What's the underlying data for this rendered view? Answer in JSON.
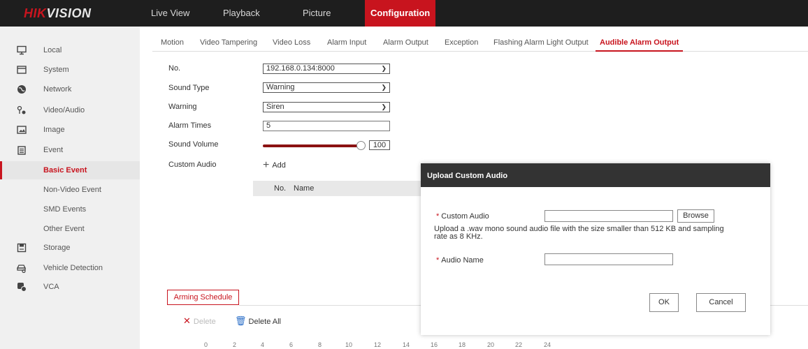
{
  "brand": {
    "part1": "HIK",
    "part2": "VISION"
  },
  "nav": {
    "items": [
      "Live View",
      "Playback",
      "Picture",
      "Configuration"
    ]
  },
  "sidebar": {
    "items": [
      {
        "label": "Local",
        "icon": "monitor-icon"
      },
      {
        "label": "System",
        "icon": "window-icon"
      },
      {
        "label": "Network",
        "icon": "globe-icon"
      },
      {
        "label": "Video/Audio",
        "icon": "camera-audio-icon"
      },
      {
        "label": "Image",
        "icon": "image-icon"
      },
      {
        "label": "Event",
        "icon": "calendar-icon"
      },
      {
        "label": "Basic Event"
      },
      {
        "label": "Non-Video Event"
      },
      {
        "label": "SMD Events"
      },
      {
        "label": "Other Event"
      },
      {
        "label": "Storage",
        "icon": "storage-icon"
      },
      {
        "label": "Vehicle Detection",
        "icon": "vehicle-icon"
      },
      {
        "label": "VCA",
        "icon": "vca-icon"
      }
    ]
  },
  "tabs": [
    "Motion",
    "Video Tampering",
    "Video Loss",
    "Alarm Input",
    "Alarm Output",
    "Exception",
    "Flashing Alarm Light Output",
    "Audible Alarm Output"
  ],
  "form": {
    "no_label": "No.",
    "no_value": "192.168.0.134:8000",
    "sound_type_label": "Sound Type",
    "sound_type_value": "Warning",
    "warning_label": "Warning",
    "warning_value": "Siren",
    "alarm_times_label": "Alarm Times",
    "alarm_times_value": "5",
    "volume_label": "Sound Volume",
    "volume_value": "100",
    "custom_audio_label": "Custom Audio",
    "add_label": "Add",
    "table_headers": [
      "No.",
      "Name"
    ]
  },
  "schedule": {
    "arming_label": "Arming Schedule",
    "delete_label": "Delete",
    "delete_all_label": "Delete All",
    "ticks": [
      "0",
      "2",
      "4",
      "6",
      "8",
      "10",
      "12",
      "14",
      "16",
      "18",
      "20",
      "22",
      "24"
    ]
  },
  "dialog": {
    "title": "Upload Custom Audio",
    "required_mark": "*",
    "custom_audio_label": "Custom Audio",
    "browse_label": "Browse",
    "hint": "Upload a .wav mono sound audio file with the size smaller than 512 KB and sampling rate as 8 KHz.",
    "audio_name_label": "Audio Name",
    "ok_label": "OK",
    "cancel_label": "Cancel"
  },
  "colors": {
    "accent": "#c8141e",
    "topbar": "#1e1e1e",
    "sidebar": "#f0f0f0",
    "dialog_header": "#333333"
  }
}
